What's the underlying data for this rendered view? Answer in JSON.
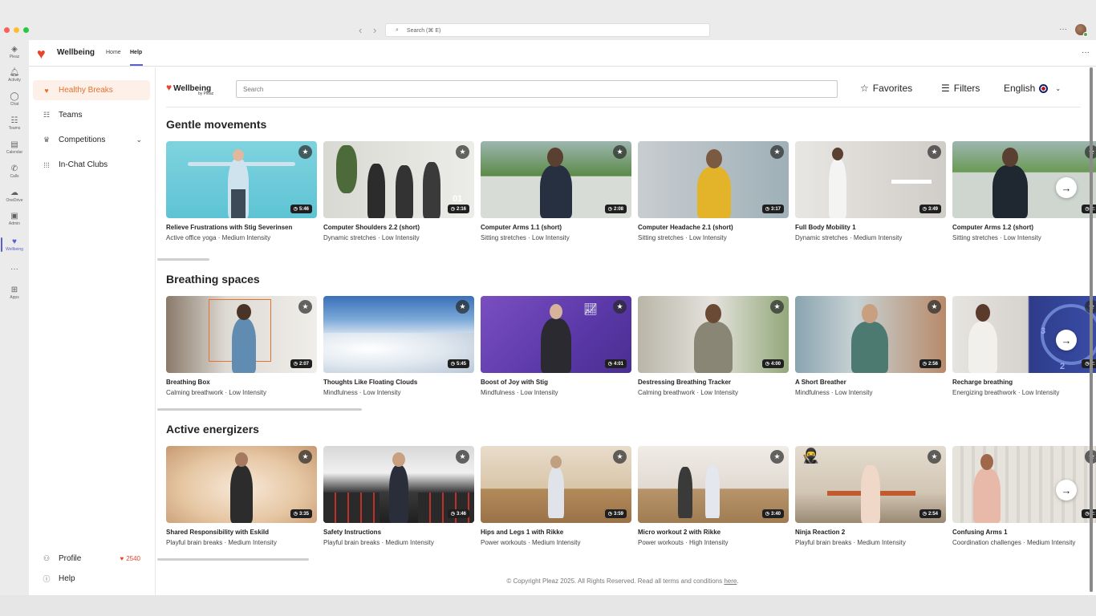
{
  "window": {
    "search_placeholder": "Search (⌘ E)",
    "more": "···"
  },
  "rail": [
    {
      "icon": "pleaz-icon",
      "glyph": "◈",
      "label": "Pleaz"
    },
    {
      "icon": "bell-icon",
      "glyph": "♫",
      "label": "Activity"
    },
    {
      "icon": "chat-icon",
      "glyph": "◯",
      "label": "Chat"
    },
    {
      "icon": "teams-icon",
      "glyph": "☷",
      "label": "Teams"
    },
    {
      "icon": "calendar-icon",
      "glyph": "▤",
      "label": "Calendar"
    },
    {
      "icon": "phone-icon",
      "glyph": "✆",
      "label": "Calls"
    },
    {
      "icon": "cloud-icon",
      "glyph": "☁",
      "label": "OneDrive"
    },
    {
      "icon": "admin-icon",
      "glyph": "▣",
      "label": "Admin"
    },
    {
      "icon": "heart-icon",
      "glyph": "♥",
      "label": "Wellbeing"
    },
    {
      "icon": "more-icon",
      "glyph": "···",
      "label": ""
    },
    {
      "icon": "apps-icon",
      "glyph": "⊞",
      "label": "Apps"
    }
  ],
  "app": {
    "name": "Wellbeing",
    "tabs": [
      "Home",
      "Help"
    ],
    "more": "···"
  },
  "sidenav": {
    "items": [
      {
        "label": "Healthy Breaks",
        "icon": "heart-icon",
        "glyph": "♥"
      },
      {
        "label": "Teams",
        "icon": "people-icon",
        "glyph": "👥"
      },
      {
        "label": "Competitions",
        "icon": "trophy-icon",
        "glyph": "🏆"
      },
      {
        "label": "In-Chat Clubs",
        "icon": "clubs-icon",
        "glyph": "⊪"
      }
    ],
    "profile": "Profile",
    "points": "2540",
    "help": "Help"
  },
  "toolbar": {
    "brand": "Wellbeing",
    "brand_sub": "by Pleaz",
    "search_placeholder": "Search",
    "favorites": "Favorites",
    "filters": "Filters",
    "language": "English"
  },
  "sections": [
    {
      "title": "Gentle movements",
      "cards": [
        {
          "title": "Relieve Frustrations with Stig Severinsen",
          "sub": "Active office yoga · Medium Intensity",
          "duration": "5:46"
        },
        {
          "title": "Computer Shoulders 2.2 (short)",
          "sub": "Dynamic stretches · Low Intensity",
          "duration": "2:16",
          "overlay": "01"
        },
        {
          "title": "Computer Arms 1.1 (short)",
          "sub": "Sitting stretches · Low Intensity",
          "duration": "2:08"
        },
        {
          "title": "Computer Headache 2.1 (short)",
          "sub": "Sitting stretches · Low Intensity",
          "duration": "3:17"
        },
        {
          "title": "Full Body Mobility 1",
          "sub": "Dynamic stretches · Medium Intensity",
          "duration": "3:49"
        },
        {
          "title": "Computer Arms 1.2 (short)",
          "sub": "Sitting stretches · Low Intensity",
          "duration": "2:"
        }
      ]
    },
    {
      "title": "Breathing spaces",
      "cards": [
        {
          "title": "Breathing Box",
          "sub": "Calming breathwork · Low Intensity",
          "duration": "2:07"
        },
        {
          "title": "Thoughts Like Floating Clouds",
          "sub": "Mindfulness · Low Intensity",
          "duration": "5:45"
        },
        {
          "title": "Boost of Joy with Stig",
          "sub": "Mindfulness · Low Intensity",
          "duration": "4:01"
        },
        {
          "title": "Destressing Breathing Tracker",
          "sub": "Calming breathwork · Low Intensity",
          "duration": "4:00"
        },
        {
          "title": "A Short Breather",
          "sub": "Mindfulness · Low Intensity",
          "duration": "2:56"
        },
        {
          "title": "Recharge breathing",
          "sub": "Energizing breathwork · Low Intensity",
          "duration": "2:",
          "overlay_a": "3",
          "overlay_b": "2"
        }
      ]
    },
    {
      "title": "Active energizers",
      "cards": [
        {
          "title": "Shared Responsibility with Eskild",
          "sub": "Playful brain breaks · Medium Intensity",
          "duration": "3:35"
        },
        {
          "title": "Safety Instructions",
          "sub": "Playful brain breaks · Medium Intensity",
          "duration": "3:46"
        },
        {
          "title": "Hips and Legs 1 with Rikke",
          "sub": "Power workouts · Medium Intensity",
          "duration": "3:59"
        },
        {
          "title": "Micro workout 2 with Rikke",
          "sub": "Power workouts · High Intensity",
          "duration": "3:40"
        },
        {
          "title": "Ninja Reaction 2",
          "sub": "Playful brain breaks · Medium Intensity",
          "duration": "2:54"
        },
        {
          "title": "Confusing Arms 1",
          "sub": "Coordination challenges · Medium Intensity",
          "duration": "2:"
        }
      ]
    }
  ],
  "footer": {
    "text": "© Copyright Pleaz 2025. All Rights Reserved. Read all terms and conditions ",
    "link": "here",
    "end": "."
  },
  "colors": {
    "brand": "#e8432d",
    "accent": "#5b5fc7",
    "active_nav": "#e8702d"
  }
}
